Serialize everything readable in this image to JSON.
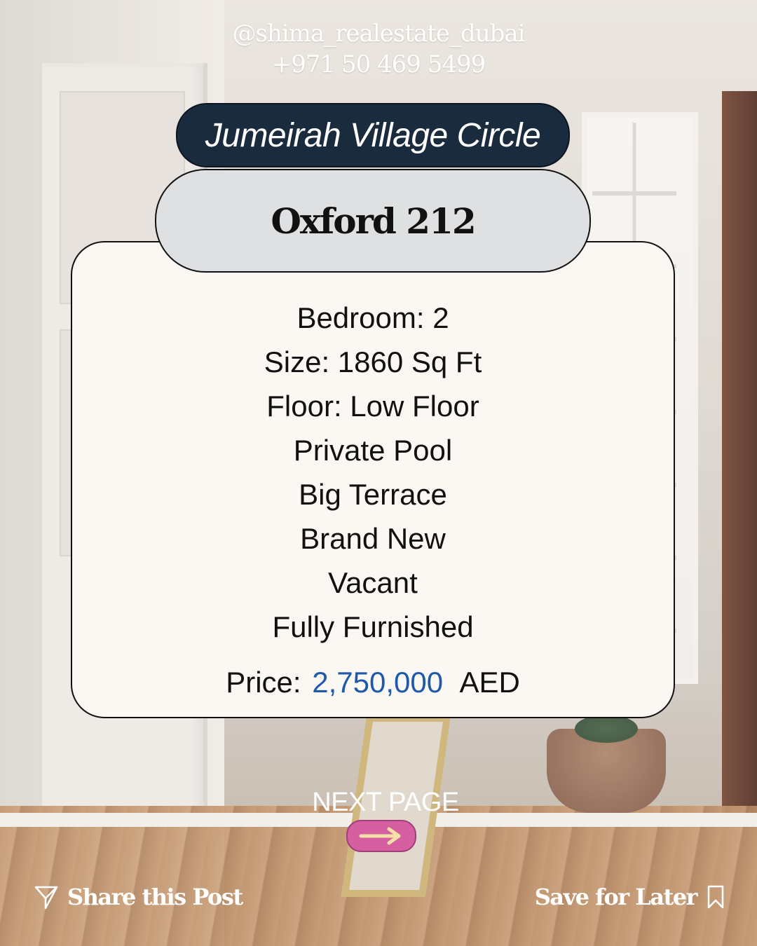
{
  "contact": {
    "handle": "@shima_realestate_dubai",
    "phone": "+971 50 469 5499"
  },
  "listing": {
    "location": "Jumeirah Village Circle",
    "name": "Oxford 212",
    "features": [
      "Bedroom: 2",
      "Size: 1860 Sq Ft",
      "Floor: Low Floor",
      "Private Pool",
      "Big Terrace",
      "Brand New",
      "Vacant",
      "Fully Furnished"
    ],
    "price_label": "Price:",
    "price_value": "2,750,000",
    "price_currency": "AED"
  },
  "navigation": {
    "next_label": "NEXT PAGE",
    "next_icon": "arrow-right-icon"
  },
  "footer": {
    "share_label": "Share this Post",
    "share_icon": "send-icon",
    "save_label": "Save for Later",
    "save_icon": "bookmark-icon"
  },
  "colors": {
    "location_pill": "#1b2b3e",
    "name_pill": "#dfe0e2",
    "card": "#fbf8f4",
    "price_accent": "#1e5aa8",
    "next_button": "#d55fa0"
  }
}
